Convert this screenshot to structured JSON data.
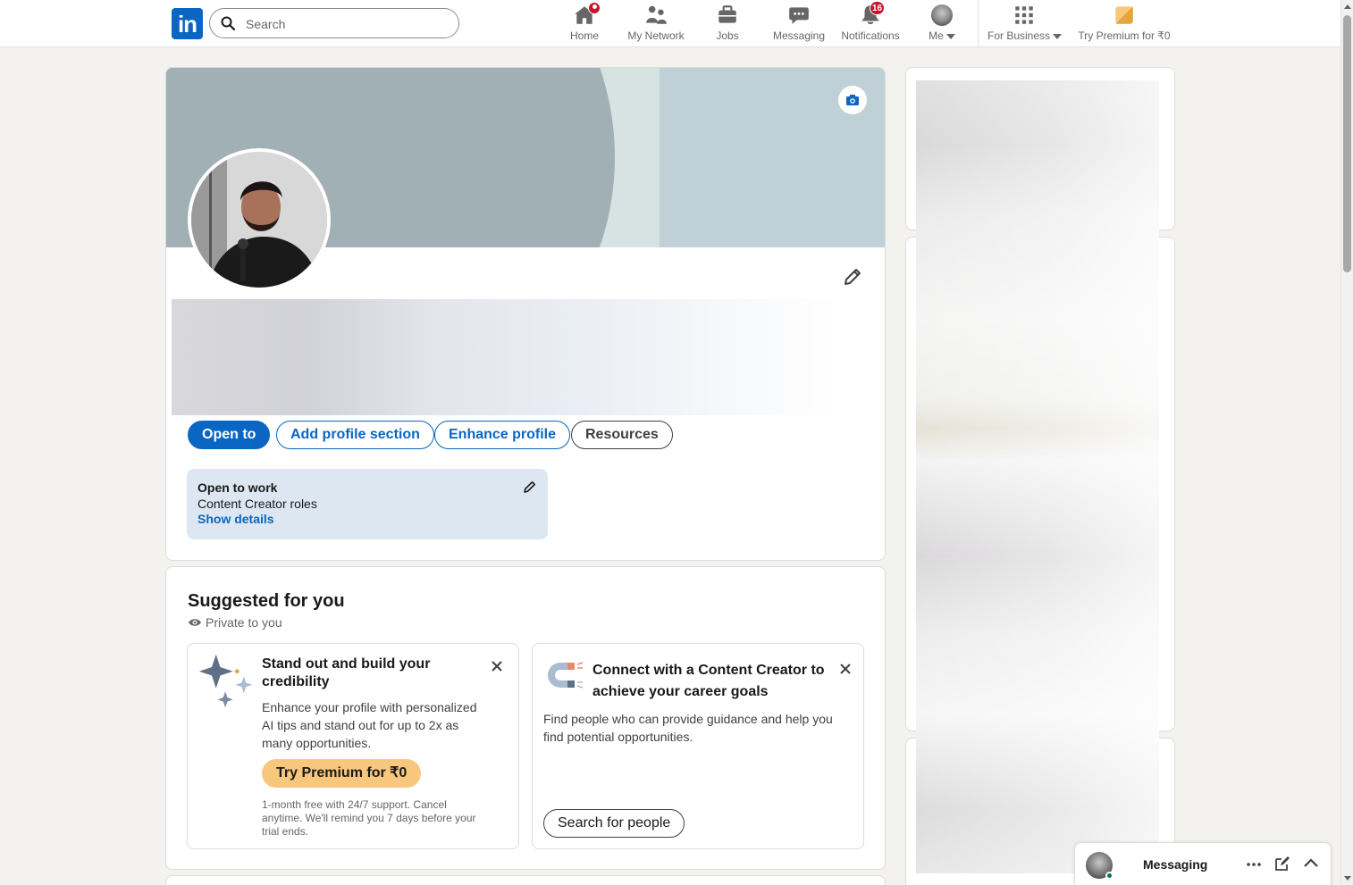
{
  "nav": {
    "logo_text": "in",
    "search_placeholder": "Search",
    "items": [
      {
        "label": "Home",
        "icon": "home-icon"
      },
      {
        "label": "My Network",
        "icon": "network-icon"
      },
      {
        "label": "Jobs",
        "icon": "jobs-icon"
      },
      {
        "label": "Messaging",
        "icon": "messaging-icon"
      },
      {
        "label": "Notifications",
        "icon": "bell-icon",
        "badge": "16"
      },
      {
        "label": "Me",
        "icon": "avatar-icon"
      },
      {
        "label": "For Business",
        "icon": "grid-icon"
      },
      {
        "label": "Try Premium for ₹0",
        "icon": "premium-icon"
      }
    ]
  },
  "profile": {
    "buttons": {
      "open_to": "Open to",
      "add_section": "Add profile section",
      "enhance": "Enhance profile",
      "resources": "Resources"
    },
    "open_to_work": {
      "title": "Open to work",
      "roles": "Content Creator roles",
      "link": "Show details"
    }
  },
  "suggested": {
    "title": "Suggested for you",
    "privacy": "Private to you",
    "card1": {
      "title": "Stand out and build your credibility",
      "desc": "Enhance your profile with personalized AI tips and stand out for up to 2x as many opportunities.",
      "button": "Try Premium for ₹0",
      "fine": "1-month free with 24/7 support. Cancel anytime. We'll remind you 7 days before your trial ends."
    },
    "card2": {
      "title": "Connect with a Content Creator to achieve your career goals",
      "desc": "Find people who can provide guidance and help you find potential opportunities.",
      "button": "Search for people"
    }
  },
  "messaging": {
    "label": "Messaging"
  },
  "colors": {
    "brand": "#0a66c2",
    "premium": "#f8c77e",
    "badge": "#cb112d",
    "open_to_work_bg": "#dde7f1"
  }
}
